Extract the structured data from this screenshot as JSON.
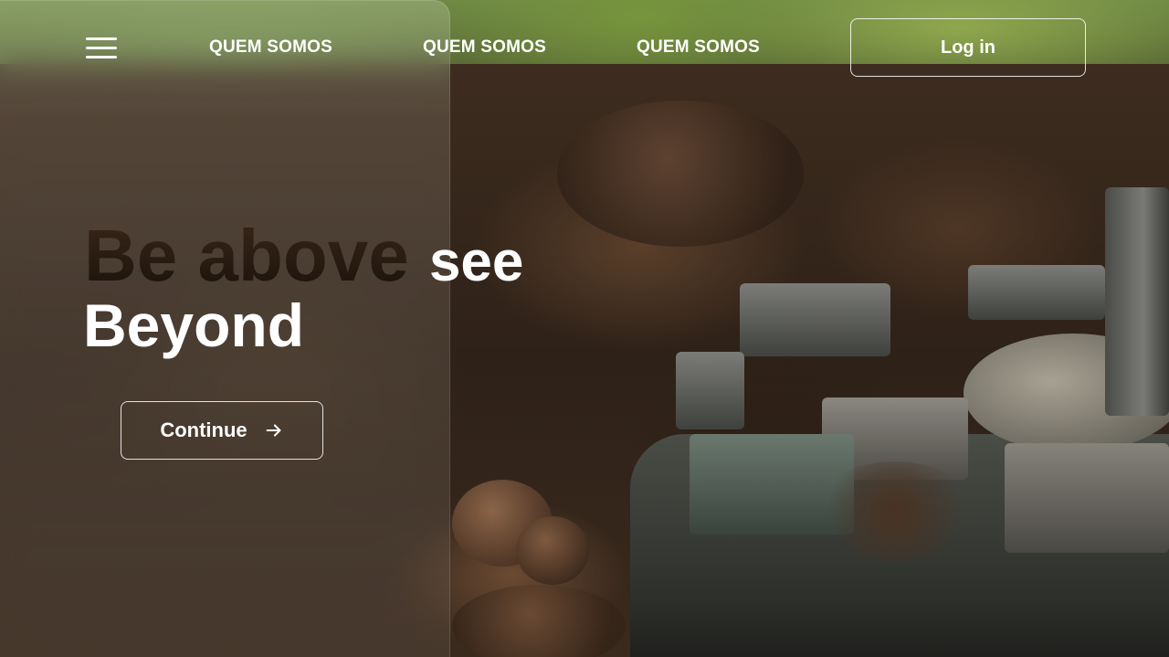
{
  "nav": {
    "menu_icon": "hamburger-menu-icon",
    "links": [
      "QUEM SOMOS",
      "QUEM SOMOS",
      "QUEM SOMOS"
    ],
    "login_label": "Log in"
  },
  "hero": {
    "title_dark": "Be above",
    "title_light": "see",
    "title_line2": "Beyond",
    "cta_label": "Continue",
    "cta_icon": "arrow-right-icon"
  },
  "colors": {
    "text_light": "#ffffff",
    "title_dark": "#2a1c12",
    "soil": "#3d2c1f",
    "grass": "#6f8a45"
  }
}
